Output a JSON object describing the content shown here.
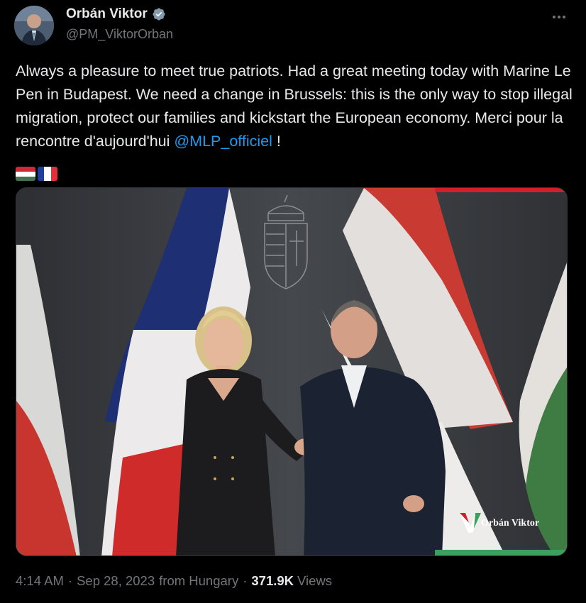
{
  "author": {
    "display_name": "Orbán Viktor",
    "handle": "@PM_ViktorOrban",
    "verified": true
  },
  "tweet": {
    "text_main": "Always a pleasure to meet true patriots. Had a great meeting today with Marine Le Pen in Budapest. We need a change in Brussels: this is the only way to stop illegal migration, protect our families and kickstart the European economy. Merci pour la rencontre d'aujourd'hui ",
    "mention": "@MLP_officiel",
    "text_end": " !",
    "flag_emojis": [
      "flag-hungary-icon",
      "flag-france-icon"
    ]
  },
  "media": {
    "watermark_text": "Orbán Viktor"
  },
  "footer": {
    "time": "4:14 AM",
    "date": "Sep 28, 2023",
    "location": "from Hungary",
    "views_count": "371.9K",
    "views_label": "Views"
  },
  "colors": {
    "background": "#000000",
    "text": "#e7e9ea",
    "muted": "#71767b",
    "link": "#1d9bf0",
    "verified": "#829aab"
  }
}
